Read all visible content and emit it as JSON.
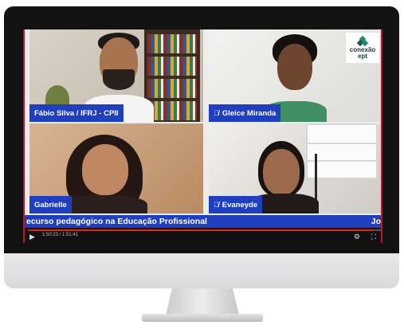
{
  "participants": [
    {
      "name": "Fábio Silva / IFRJ - CPII",
      "muted": false
    },
    {
      "name": "Gleice Miranda",
      "muted": true
    },
    {
      "name": "Gabrielle",
      "muted": false
    },
    {
      "name": "Evaneyde",
      "muted": true
    }
  ],
  "logo": {
    "line1": "conexão",
    "line2": "ept"
  },
  "caption": {
    "text": "ecurso pedagógico na Educação Profissional",
    "right_fragment": "Jo"
  },
  "player": {
    "time": "1:50:23 / 1:51:41",
    "progress_fraction": 0.98,
    "play_icon": "▶",
    "controls": [
      "⚙",
      "⛶"
    ]
  },
  "colors": {
    "brand_blue": "#1f3fbf",
    "accent_red": "#c8102e",
    "logo_green": "#1a8c6a",
    "logo_teal": "#2a4d6a"
  },
  "icons": [
    "mic-off-icon",
    "play-icon",
    "settings-icon",
    "fullscreen-icon",
    "logo-mark-icon"
  ]
}
